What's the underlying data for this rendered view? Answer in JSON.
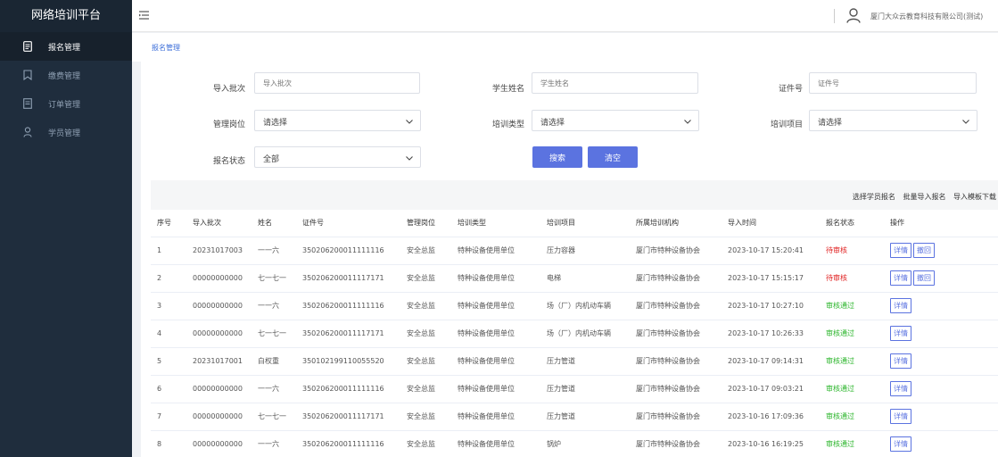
{
  "app": {
    "title": "网络培训平台"
  },
  "sidebar": {
    "items": [
      {
        "label": "报名管理",
        "icon": "document-icon"
      },
      {
        "label": "缴费管理",
        "icon": "bookmark-icon"
      },
      {
        "label": "订单管理",
        "icon": "list-doc-icon"
      },
      {
        "label": "学员管理",
        "icon": "person-icon"
      }
    ]
  },
  "header": {
    "company": "厦门大众云教育科技有限公司(测试)"
  },
  "breadcrumb": {
    "label": "报名管理"
  },
  "filters": {
    "batch_label": "导入批次",
    "batch_placeholder": "导入批次",
    "student_label": "学生姓名",
    "student_placeholder": "学生姓名",
    "cert_label": "证件号",
    "cert_placeholder": "证件号",
    "post_label": "管理岗位",
    "post_value": "请选择",
    "type_label": "培训类型",
    "type_value": "请选择",
    "project_label": "培训项目",
    "project_value": "请选择",
    "status_label": "报名状态",
    "status_value": "全部",
    "search_label": "搜索",
    "clear_label": "清空"
  },
  "table_actions": {
    "select_student": "选择学员报名",
    "batch_import": "批量导入报名",
    "import_template": "导入模板下载"
  },
  "table": {
    "headers": [
      "序号",
      "导入批次",
      "姓名",
      "证件号",
      "管理岗位",
      "培训类型",
      "培训项目",
      "所属培训机构",
      "导入时间",
      "报名状态",
      "操作"
    ],
    "detail_label": "详情",
    "revoke_label": "撤回",
    "rows": [
      {
        "no": "1",
        "batch": "20231017003",
        "name": "一一六",
        "cert": "350206200011111116",
        "post": "安全总监",
        "type": "特种设备使用单位",
        "project": "压力容器",
        "org": "厦门市特种设备协会",
        "time": "2023-10-17 15:20:41",
        "status": "待审核",
        "status_kind": "pending",
        "revoke": true
      },
      {
        "no": "2",
        "batch": "00000000000",
        "name": "七一七一",
        "cert": "350206200011117171",
        "post": "安全总监",
        "type": "特种设备使用单位",
        "project": "电梯",
        "org": "厦门市特种设备协会",
        "time": "2023-10-17 15:15:17",
        "status": "待审核",
        "status_kind": "pending",
        "revoke": true
      },
      {
        "no": "3",
        "batch": "00000000000",
        "name": "一一六",
        "cert": "350206200011111116",
        "post": "安全总监",
        "type": "特种设备使用单位",
        "project": "场（厂）内机动车辆",
        "org": "厦门市特种设备协会",
        "time": "2023-10-17 10:27:10",
        "status": "审核通过",
        "status_kind": "pass",
        "revoke": false
      },
      {
        "no": "4",
        "batch": "00000000000",
        "name": "七一七一",
        "cert": "350206200011117171",
        "post": "安全总监",
        "type": "特种设备使用单位",
        "project": "场（厂）内机动车辆",
        "org": "厦门市特种设备协会",
        "time": "2023-10-17 10:26:33",
        "status": "审核通过",
        "status_kind": "pass",
        "revoke": false
      },
      {
        "no": "5",
        "batch": "20231017001",
        "name": "白权重",
        "cert": "350102199110055520",
        "post": "安全总监",
        "type": "特种设备使用单位",
        "project": "压力管道",
        "org": "厦门市特种设备协会",
        "time": "2023-10-17 09:14:31",
        "status": "审核通过",
        "status_kind": "pass",
        "revoke": false
      },
      {
        "no": "6",
        "batch": "00000000000",
        "name": "一一六",
        "cert": "350206200011111116",
        "post": "安全总监",
        "type": "特种设备使用单位",
        "project": "压力管道",
        "org": "厦门市特种设备协会",
        "time": "2023-10-17 09:03:21",
        "status": "审核通过",
        "status_kind": "pass",
        "revoke": false
      },
      {
        "no": "7",
        "batch": "00000000000",
        "name": "七一七一",
        "cert": "350206200011117171",
        "post": "安全总监",
        "type": "特种设备使用单位",
        "project": "压力管道",
        "org": "厦门市特种设备协会",
        "time": "2023-10-16 17:09:36",
        "status": "审核通过",
        "status_kind": "pass",
        "revoke": false
      },
      {
        "no": "8",
        "batch": "00000000000",
        "name": "一一六",
        "cert": "350206200011111116",
        "post": "安全总监",
        "type": "特种设备使用单位",
        "project": "锅炉",
        "org": "厦门市特种设备协会",
        "time": "2023-10-16 16:19:25",
        "status": "审核通过",
        "status_kind": "pass",
        "revoke": false
      }
    ]
  },
  "colors": {
    "sidebar": "#1f2d3d",
    "accent": "#5b73e0",
    "link": "#3d6fd9",
    "pending": "#e02020",
    "pass": "#2bb52b"
  }
}
